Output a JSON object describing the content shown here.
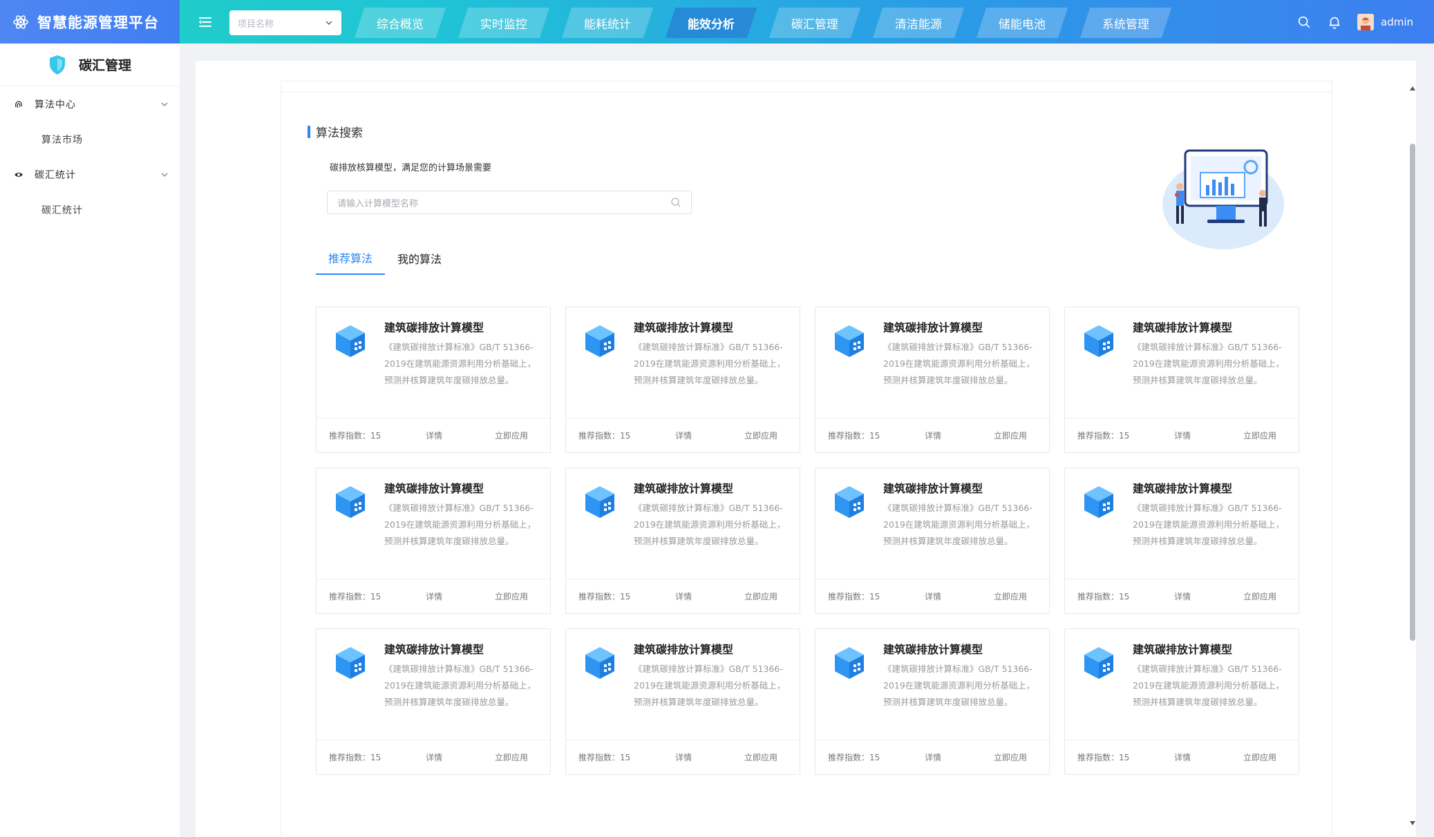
{
  "app": {
    "title": "智慧能源管理平台",
    "accent": "#2f86f3"
  },
  "header": {
    "project_placeholder": "项目名称",
    "nav": [
      "综合概览",
      "实时监控",
      "能耗统计",
      "能效分析",
      "碳汇管理",
      "清洁能源",
      "储能电池",
      "系统管理"
    ],
    "active_nav": "能效分析",
    "user": "admin"
  },
  "sidebar": {
    "title": "碳汇管理",
    "groups": [
      {
        "label": "算法中心",
        "icon": "fingerprint-icon",
        "items": [
          "算法市场"
        ]
      },
      {
        "label": "碳汇统计",
        "icon": "eye-icon",
        "items": [
          "碳汇统计"
        ]
      }
    ]
  },
  "main": {
    "section_title": "算法搜索",
    "description": "碳排放核算模型，满足您的计算场景需要",
    "search_placeholder": "请输入计算模型名称",
    "tabs": [
      "推荐算法",
      "我的算法"
    ],
    "active_tab": "推荐算法",
    "cards": [
      {
        "title": "建筑碳排放计算模型",
        "desc": "《建筑碳排放计算标准》GB/T 51366-2019在建筑能源资源利用分析基础上，预测并核算建筑年度碳排放总量。",
        "score": "推荐指数：15",
        "detail": "详情",
        "apply": "立即应用"
      },
      {
        "title": "建筑碳排放计算模型",
        "desc": "《建筑碳排放计算标准》GB/T 51366-2019在建筑能源资源利用分析基础上，预测并核算建筑年度碳排放总量。",
        "score": "推荐指数：15",
        "detail": "详情",
        "apply": "立即应用"
      },
      {
        "title": "建筑碳排放计算模型",
        "desc": "《建筑碳排放计算标准》GB/T 51366-2019在建筑能源资源利用分析基础上，预测并核算建筑年度碳排放总量。",
        "score": "推荐指数：15",
        "detail": "详情",
        "apply": "立即应用"
      },
      {
        "title": "建筑碳排放计算模型",
        "desc": "《建筑碳排放计算标准》GB/T 51366-2019在建筑能源资源利用分析基础上，预测并核算建筑年度碳排放总量。",
        "score": "推荐指数：15",
        "detail": "详情",
        "apply": "立即应用"
      },
      {
        "title": "建筑碳排放计算模型",
        "desc": "《建筑碳排放计算标准》GB/T 51366-2019在建筑能源资源利用分析基础上，预测并核算建筑年度碳排放总量。",
        "score": "推荐指数：15",
        "detail": "详情",
        "apply": "立即应用"
      },
      {
        "title": "建筑碳排放计算模型",
        "desc": "《建筑碳排放计算标准》GB/T 51366-2019在建筑能源资源利用分析基础上，预测并核算建筑年度碳排放总量。",
        "score": "推荐指数：15",
        "detail": "详情",
        "apply": "立即应用"
      },
      {
        "title": "建筑碳排放计算模型",
        "desc": "《建筑碳排放计算标准》GB/T 51366-2019在建筑能源资源利用分析基础上，预测并核算建筑年度碳排放总量。",
        "score": "推荐指数：15",
        "detail": "详情",
        "apply": "立即应用"
      },
      {
        "title": "建筑碳排放计算模型",
        "desc": "《建筑碳排放计算标准》GB/T 51366-2019在建筑能源资源利用分析基础上，预测并核算建筑年度碳排放总量。",
        "score": "推荐指数：15",
        "detail": "详情",
        "apply": "立即应用"
      },
      {
        "title": "建筑碳排放计算模型",
        "desc": "《建筑碳排放计算标准》GB/T 51366-2019在建筑能源资源利用分析基础上，预测并核算建筑年度碳排放总量。",
        "score": "推荐指数：15",
        "detail": "详情",
        "apply": "立即应用"
      },
      {
        "title": "建筑碳排放计算模型",
        "desc": "《建筑碳排放计算标准》GB/T 51366-2019在建筑能源资源利用分析基础上，预测并核算建筑年度碳排放总量。",
        "score": "推荐指数：15",
        "detail": "详情",
        "apply": "立即应用"
      },
      {
        "title": "建筑碳排放计算模型",
        "desc": "《建筑碳排放计算标准》GB/T 51366-2019在建筑能源资源利用分析基础上，预测并核算建筑年度碳排放总量。",
        "score": "推荐指数：15",
        "detail": "详情",
        "apply": "立即应用"
      },
      {
        "title": "建筑碳排放计算模型",
        "desc": "《建筑碳排放计算标准》GB/T 51366-2019在建筑能源资源利用分析基础上，预测并核算建筑年度碳排放总量。",
        "score": "推荐指数：15",
        "detail": "详情",
        "apply": "立即应用"
      }
    ]
  }
}
